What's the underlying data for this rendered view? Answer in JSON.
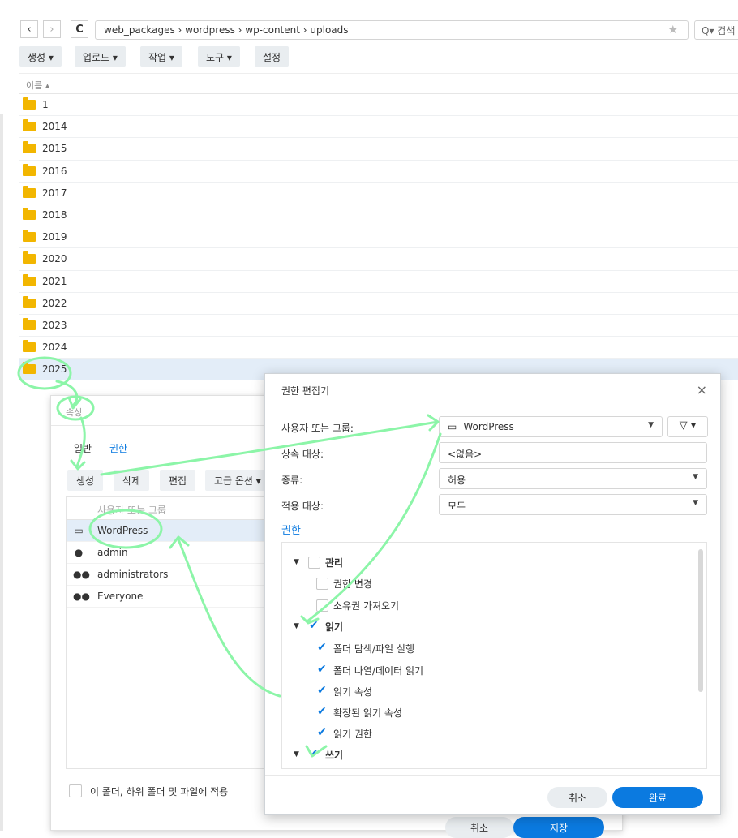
{
  "toolbar": {
    "back": "‹",
    "forward": "›",
    "refresh": "C",
    "path": "web_packages › wordpress › wp-content › uploads",
    "search": "Q▾ 검색",
    "menus": [
      "생성 ▾",
      "업로드 ▾",
      "작업 ▾",
      "도구 ▾",
      "설정"
    ]
  },
  "list": {
    "header": "이름 ▴",
    "folders": [
      "1",
      "2014",
      "2015",
      "2016",
      "2017",
      "2018",
      "2019",
      "2020",
      "2021",
      "2022",
      "2023",
      "2024",
      "2025"
    ]
  },
  "props": {
    "title": "속성",
    "tabs": [
      "일반",
      "권한"
    ],
    "buttons": [
      "생성",
      "삭제",
      "편집",
      "고급 옵션 ▾"
    ],
    "table_header": "사용자 또는 그룹",
    "entries": [
      {
        "icon": "▭",
        "name": "WordPress"
      },
      {
        "icon": "👤",
        "name": "admin"
      },
      {
        "icon": "👥",
        "name": "administrators"
      },
      {
        "icon": "👥",
        "name": "Everyone"
      }
    ],
    "apply_label": "이 폴더, 하위 폴더 및 파일에 적용",
    "cancel": "취소",
    "save": "저장"
  },
  "editor": {
    "title": "권한 편집기",
    "close": "×",
    "user_label": "사용자 또는 그룹:",
    "user_value": "WordPress",
    "inherit_label": "상속 대상:",
    "inherit_value": "<없음>",
    "type_label": "종류:",
    "type_value": "허용",
    "apply_label": "적용 대상:",
    "apply_value": "모두",
    "section": "권한",
    "tree": {
      "admin_group": "관리",
      "change_perm": "권한 변경",
      "take_ownership": "소유권 가져오기",
      "read_group": "읽기",
      "read_items": [
        "폴더 탐색/파일 실행",
        "폴더 나열/데이터 읽기",
        "읽기 속성",
        "확장된 읽기 속성",
        "읽기 권한"
      ],
      "write_group": "쓰기"
    },
    "cancel": "취소",
    "done": "완료"
  },
  "colors": {
    "accent": "#0b7ae0",
    "folder": "#f2b600",
    "annotation": "#8cf5a8"
  }
}
